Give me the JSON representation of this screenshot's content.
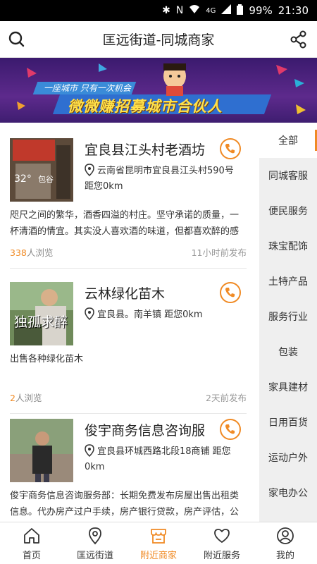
{
  "statusbar": {
    "network": "4G",
    "battery": "99%",
    "time": "21:30"
  },
  "header": {
    "title": "匡远街道-同城商家"
  },
  "banner": {
    "slogan_small": "一座城市   只有一次机会",
    "slogan_big": "微微赚招募城市合伙人"
  },
  "listings": [
    {
      "name": "宜良县江头村老酒坊",
      "address": "云南省昆明市宜良县江头村590号",
      "distance_label": "距您",
      "distance": "0km",
      "description_line1": "咫尺之间的繁华，酒香四溢的村庄。坚守承诺的质量，一",
      "description_line2": "杯清酒的情宜。其实没人喜欢酒的味道，但都喜欢醉的感",
      "views": "338",
      "views_suffix": "人浏览",
      "time": "11小时前发布"
    },
    {
      "name": "云林绿化苗木",
      "address": "宜良县。南羊镇 距您0km",
      "image_text": "独孤求醉",
      "description_line1": "出售各种绿化苗木",
      "views": "2",
      "views_suffix": "人浏览",
      "time": "2天前发布"
    },
    {
      "name": "俊宇商务信息咨询服",
      "address_line1": "宜良县环城西路北段18商铺 距您",
      "address_line2": "0km",
      "description_line1": "俊宇商务信息咨询服务部：长期免费发布房屋出售出租类",
      "description_line2": "信息。代办房产过户手续，房产银行贷款，房产评估，公"
    }
  ],
  "categories": [
    "全部",
    "同城客服",
    "便民服务",
    "珠宝配饰",
    "土特产品",
    "服务行业",
    "包装",
    "家具建材",
    "日用百货",
    "运动户外",
    "家电办公"
  ],
  "bottom_nav": [
    "首页",
    "匡远街道",
    "附近商家",
    "附近服务",
    "我的"
  ],
  "colors": {
    "accent": "#f08a24",
    "banner_bg": "#4a2380",
    "category_bg": "#efefef"
  }
}
